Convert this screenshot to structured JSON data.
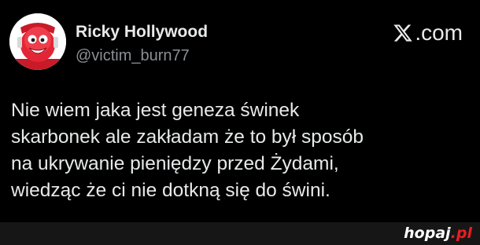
{
  "post": {
    "author_name": "Ricky Hollywood",
    "author_handle": "@victim_burn77",
    "platform": {
      "logo_icon": "x-logo-icon",
      "domain_suffix": ".com"
    },
    "avatar_icon": "kool-aid-man-avatar",
    "text_lines": [
      "Nie wiem jaka jest geneza świnek",
      "skarbonek ale zakładam że to był sposób",
      "na ukrywanie pieniędzy przed Żydami,",
      "wiedząc że ci nie dotkną się do świni."
    ]
  },
  "watermark": {
    "main": "hopaj",
    "tld": ".pl"
  },
  "colors": {
    "background": "#000000",
    "text": "#e7e9ea",
    "handle": "#8b8f94",
    "watermark_bar": "#161616",
    "watermark_accent": "#ea1d24"
  }
}
